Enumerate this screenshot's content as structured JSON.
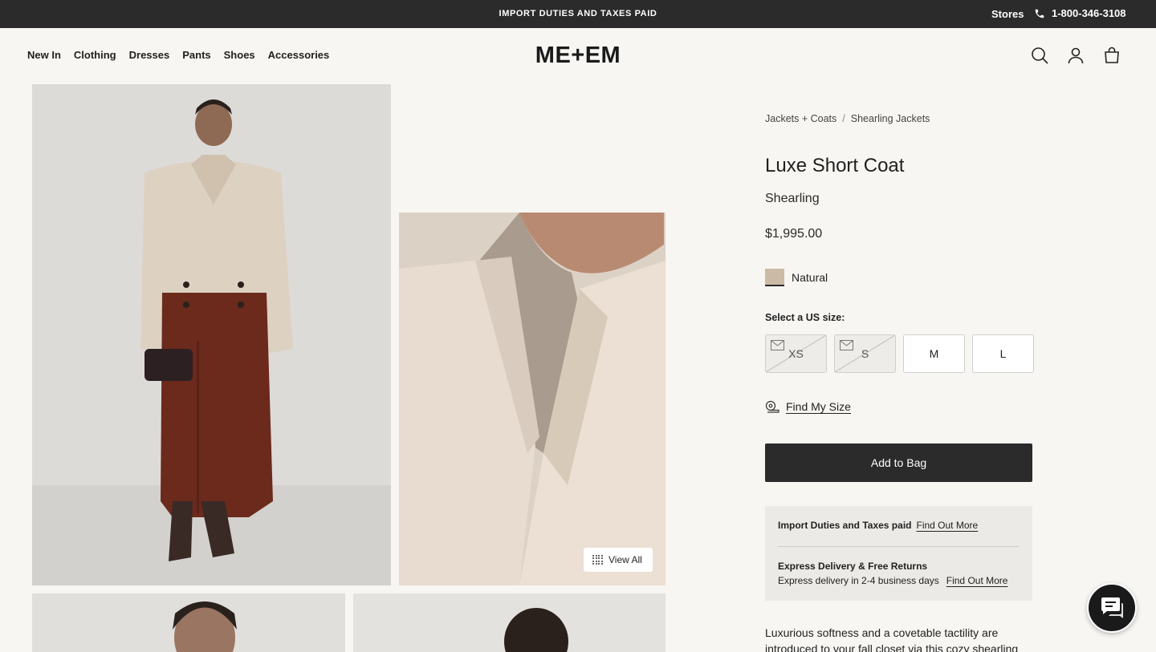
{
  "announcement": {
    "text": "IMPORT DUTIES AND TAXES PAID",
    "stores": "Stores",
    "phone": "1-800-346-3108"
  },
  "header": {
    "logo": "ME+EM",
    "nav": [
      "New In",
      "Clothing",
      "Dresses",
      "Pants",
      "Shoes",
      "Accessories"
    ],
    "icons": [
      "search-icon",
      "account-icon",
      "bag-icon"
    ]
  },
  "gallery": {
    "view_all": "View All"
  },
  "product": {
    "breadcrumb": [
      "Jackets + Coats",
      "Shearling Jackets"
    ],
    "breadcrumb_separator": "/",
    "title": "Luxe Short Coat",
    "subtitle": "Shearling",
    "price": "$1,995.00",
    "color": {
      "name": "Natural",
      "swatch": "#cbbba6"
    },
    "size_label": "Select a US size:",
    "sizes": [
      {
        "label": "XS",
        "available": false
      },
      {
        "label": "S",
        "available": false
      },
      {
        "label": "M",
        "available": true
      },
      {
        "label": "L",
        "available": true
      }
    ],
    "find_my_size": "Find My Size",
    "add_to_bag": "Add to Bag",
    "info": {
      "duties_title": "Import Duties and Taxes paid",
      "duties_link": "Find Out More",
      "delivery_title": "Express Delivery & Free Returns",
      "delivery_text": "Express delivery in 2-4 business days",
      "delivery_link": "Find Out More"
    },
    "description": "Luxurious softness and a covetable tactility are introduced to your fall closet via this cozy shearling"
  },
  "colors": {
    "dark": "#2b2b2b",
    "background": "#f7f6f2",
    "info_panel": "#eceae6"
  }
}
